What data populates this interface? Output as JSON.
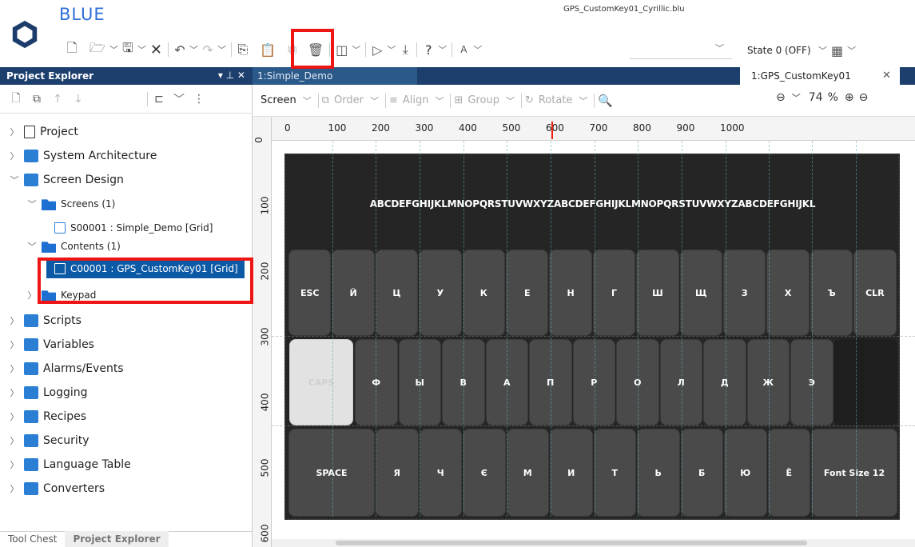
{
  "app": {
    "name": "BLUE",
    "filename": "GPS_CustomKey01_Cyrillic.blu"
  },
  "toolbar": {
    "state_label": "State 0 (OFF)"
  },
  "explorer": {
    "title": "Project Explorer",
    "items": [
      {
        "label": "Project",
        "icon": "doc-icon"
      },
      {
        "label": "System Architecture",
        "icon": "architecture-icon"
      },
      {
        "label": "Screen Design",
        "icon": "screen-design-icon"
      },
      {
        "label": "Screens (1)",
        "icon": "folder-icon"
      },
      {
        "label": "S00001 : Simple_Demo [Grid]",
        "icon": "screen-icon"
      },
      {
        "label": "Contents (1)",
        "icon": "folder-icon"
      },
      {
        "label": "C00001 : GPS_CustomKey01 [Grid]",
        "icon": "screen-icon"
      },
      {
        "label": "Keypad",
        "icon": "folder-icon"
      },
      {
        "label": "Scripts",
        "icon": "scripts-icon"
      },
      {
        "label": "Variables",
        "icon": "variables-icon"
      },
      {
        "label": "Alarms/Events",
        "icon": "alarms-icon"
      },
      {
        "label": "Logging",
        "icon": "logging-icon"
      },
      {
        "label": "Recipes",
        "icon": "recipes-icon"
      },
      {
        "label": "Security",
        "icon": "security-icon"
      },
      {
        "label": "Language Table",
        "icon": "language-icon"
      },
      {
        "label": "Converters",
        "icon": "converters-icon"
      }
    ],
    "bottom_tabs": [
      "Tool Chest",
      "Project Explorer"
    ]
  },
  "doc_tabs": [
    {
      "label": "1:Simple_Demo"
    },
    {
      "label": "1:GPS_CustomKey01"
    }
  ],
  "editor_tools": {
    "screen": "Screen",
    "order": "Order",
    "align": "Align",
    "group": "Group",
    "rotate": "Rotate",
    "zoom_value": "74",
    "zoom_unit": "%"
  },
  "ruler": {
    "h": [
      "0",
      "100",
      "200",
      "300",
      "400",
      "500",
      "600",
      "700",
      "800",
      "900",
      "1000"
    ],
    "v": [
      "0",
      "100",
      "200",
      "300",
      "400",
      "500",
      "600"
    ]
  },
  "keyboard": {
    "display_text": "ABCDEFGHIJKLMNOPQRSTUVWXYZABCDEFGHIJKLMNOPQRSTUVWXYZABCDEFGHIJKL",
    "row1": [
      "ESC",
      "Й",
      "Ц",
      "У",
      "К",
      "Е",
      "Н",
      "Г",
      "Ш",
      "Щ",
      "З",
      "Х",
      "Ъ",
      "CLR"
    ],
    "row2": [
      "CAPS",
      "Ф",
      "Ы",
      "В",
      "А",
      "П",
      "Р",
      "О",
      "Л",
      "Д",
      "Ж",
      "Э"
    ],
    "row3": [
      "SPACE",
      "Я",
      "Ч",
      "Є",
      "М",
      "И",
      "Т",
      "Ь",
      "Б",
      "Ю",
      "Ё",
      "Font Size 12"
    ]
  },
  "colors": {
    "accent": "#1d3f6e",
    "selection": "#0c5aa6",
    "highlight": "#ee1515",
    "key_bg": "#4a4a4a",
    "panel_bg": "#252525"
  }
}
